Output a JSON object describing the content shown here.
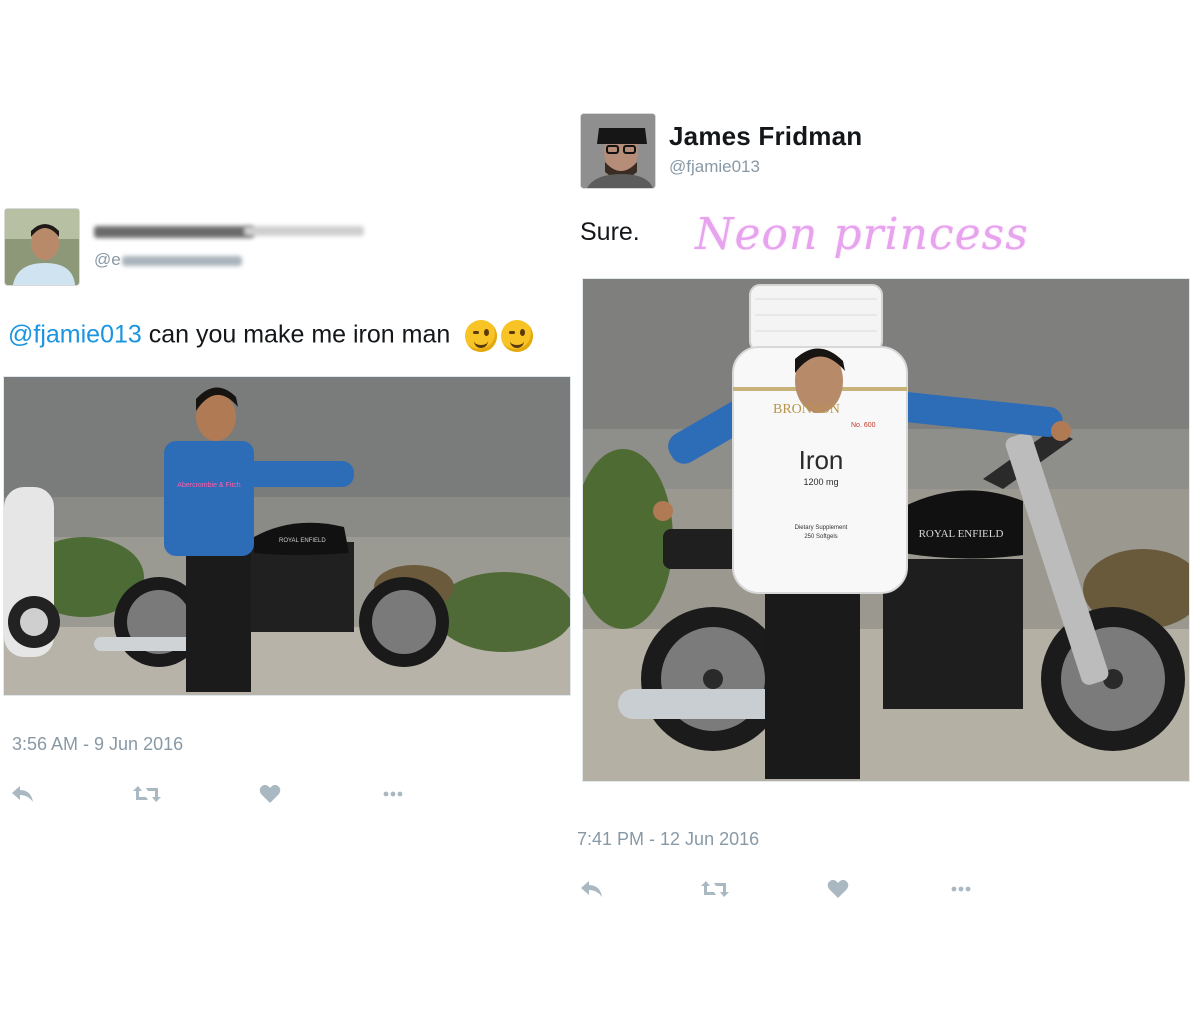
{
  "left_tweet": {
    "author": {
      "name": "",
      "handle": "@e",
      "name_redacted": true
    },
    "text": {
      "mention": "@fjamie013",
      "body": " can you make  me iron man"
    },
    "emojis": [
      "winking-face",
      "winking-face"
    ],
    "timestamp": "3:56 AM - 9 Jun 2016",
    "media": {
      "shirt_text": "Abercrombie & Fitch",
      "tank_text": "ROYAL ENFIELD"
    }
  },
  "right_tweet": {
    "author": {
      "name": "James Fridman",
      "handle": "@fjamie013"
    },
    "text": "Sure.",
    "watermark": "Neon princess",
    "timestamp": "7:41 PM - 12 Jun 2016",
    "media": {
      "bottle": {
        "brand": "BRONSON",
        "number": "No. 600",
        "product": "Iron",
        "dose": "1200 mg",
        "line1": "Dietary Supplement",
        "line2": "250 Softgels"
      },
      "tank_text": "ROYAL ENFIELD"
    }
  },
  "actions": {
    "icons": [
      "reply-icon",
      "retweet-icon",
      "like-icon",
      "more-icon"
    ]
  },
  "colors": {
    "link": "#1b95e0",
    "muted": "#8899a6",
    "watermark": "#e7a3ee"
  }
}
